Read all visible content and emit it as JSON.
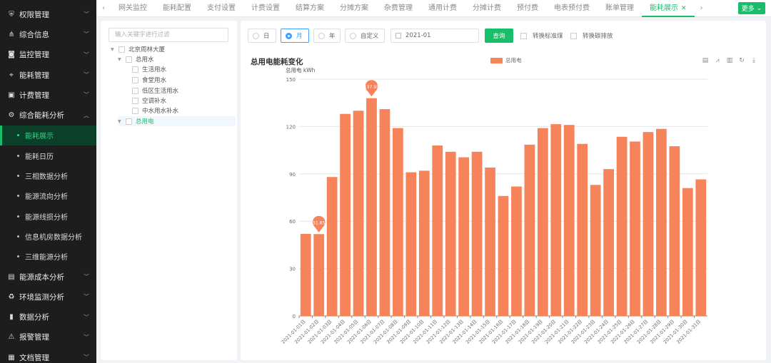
{
  "sidebar": {
    "items": [
      {
        "label": "权限管理",
        "icon": "shield-icon"
      },
      {
        "label": "综合信息",
        "icon": "share-icon"
      },
      {
        "label": "监控管理",
        "icon": "monitor-icon"
      },
      {
        "label": "能耗管理",
        "icon": "location-icon"
      },
      {
        "label": "计费管理",
        "icon": "billing-icon"
      },
      {
        "label": "综合能耗分析",
        "icon": "gear-icon"
      }
    ],
    "sub_items": [
      {
        "label": "能耗展示"
      },
      {
        "label": "能耗日历"
      },
      {
        "label": "三相数据分析"
      },
      {
        "label": "能源流向分析"
      },
      {
        "label": "能源线损分析"
      },
      {
        "label": "信息机房数据分析"
      },
      {
        "label": "三维能源分析"
      }
    ],
    "items_after": [
      {
        "label": "能源成本分析",
        "icon": "cost-icon"
      },
      {
        "label": "环境监测分析",
        "icon": "recycle-icon"
      },
      {
        "label": "数据分析",
        "icon": "bar-chart-icon"
      },
      {
        "label": "报警管理",
        "icon": "alarm-icon"
      },
      {
        "label": "文档管理",
        "icon": "document-icon"
      }
    ]
  },
  "tabs": [
    {
      "label": "网关监控"
    },
    {
      "label": "能耗配置"
    },
    {
      "label": "支付设置"
    },
    {
      "label": "计费设置"
    },
    {
      "label": "结算方案"
    },
    {
      "label": "分摊方案"
    },
    {
      "label": "杂费管理"
    },
    {
      "label": "通用计费"
    },
    {
      "label": "分摊计费"
    },
    {
      "label": "预付费"
    },
    {
      "label": "电表预付费"
    },
    {
      "label": "账单管理"
    },
    {
      "label": "能耗展示",
      "active": true
    }
  ],
  "more_label": "更多",
  "tree": {
    "search_placeholder": "输入关键字进行过滤",
    "nodes": [
      {
        "label": "北京周林大厦",
        "level": 0,
        "caret": true
      },
      {
        "label": "总用水",
        "level": 1,
        "caret": true
      },
      {
        "label": "生活用水",
        "level": 2
      },
      {
        "label": "食堂用水",
        "level": 2
      },
      {
        "label": "低区生活用水",
        "level": 2
      },
      {
        "label": "空调补水",
        "level": 2
      },
      {
        "label": "中水用水补水",
        "level": 2
      },
      {
        "label": "总用电",
        "level": 1,
        "caret": true,
        "selected": true
      }
    ]
  },
  "filters": {
    "radios": [
      {
        "label": "日"
      },
      {
        "label": "月",
        "selected": true
      },
      {
        "label": "年"
      },
      {
        "label": "自定义"
      }
    ],
    "date_value": "2021-01",
    "query_label": "查询",
    "checkbox_1": "转换标准煤",
    "checkbox_2": "转换碳排放"
  },
  "accent_color": "#19be6b",
  "bar_color": "#f6835a",
  "chart_data": {
    "type": "bar",
    "title": "总用电能耗变化",
    "ylabel": "总用电 kWh",
    "legend": "总用电",
    "ylim": [
      0,
      150
    ],
    "yticks": [
      0,
      30,
      60,
      90,
      120,
      150
    ],
    "categories": [
      "2021-01-01日",
      "2021-01-02日",
      "2021-01-03日",
      "2021-01-04日",
      "2021-01-05日",
      "2021-01-06日",
      "2021-01-07日",
      "2021-01-08日",
      "2021-01-09日",
      "2021-01-10日",
      "2021-01-11日",
      "2021-01-12日",
      "2021-01-13日",
      "2021-01-14日",
      "2021-01-15日",
      "2021-01-16日",
      "2021-01-17日",
      "2021-01-18日",
      "2021-01-19日",
      "2021-01-20日",
      "2021-01-21日",
      "2021-01-22日",
      "2021-01-23日",
      "2021-01-24日",
      "2021-01-25日",
      "2021-01-26日",
      "2021-01-27日",
      "2021-01-28日",
      "2021-01-29日",
      "2021-01-30日",
      "2021-01-31日"
    ],
    "values": [
      52,
      51.85,
      88,
      128,
      130,
      137.95,
      131,
      119,
      91,
      92,
      108,
      104,
      100.5,
      104,
      94,
      76,
      82,
      108.5,
      119,
      121.5,
      121,
      109,
      83,
      93,
      113.5,
      110.5,
      116.5,
      118.5,
      107.5,
      81,
      86.5
    ],
    "markers": [
      {
        "index": 1,
        "label": "51.85"
      },
      {
        "index": 5,
        "label": "137.95"
      }
    ],
    "grid": true
  }
}
